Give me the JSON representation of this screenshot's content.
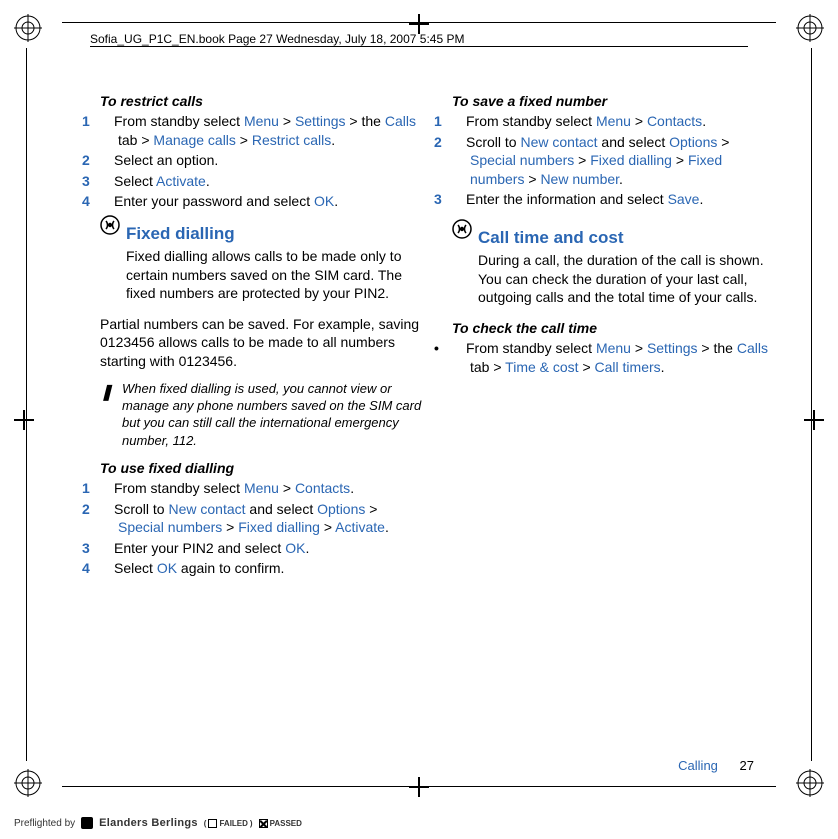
{
  "header": {
    "running_head": "Sofia_UG_P1C_EN.book  Page 27  Wednesday, July 18, 2007  5:45 PM"
  },
  "left": {
    "restrict": {
      "title": "To restrict calls",
      "step1_a": "From standby select ",
      "step1_menu": "Menu",
      "step1_gt1": " > ",
      "step1_settings": "Settings",
      "step1_b": " > the ",
      "step1_calls": "Calls",
      "step1_c": " tab > ",
      "step1_manage": "Manage calls",
      "step1_gt2": " > ",
      "step1_restrict": "Restrict calls",
      "step1_d": ".",
      "step2": "Select an option.",
      "step3_a": "Select ",
      "step3_activate": "Activate",
      "step3_b": ".",
      "step4_a": "Enter your password and select ",
      "step4_ok": "OK",
      "step4_b": "."
    },
    "fixed": {
      "title": "Fixed dialling",
      "p1": "Fixed dialling allows calls to be made only to certain numbers saved on the SIM card. The fixed numbers are protected by your PIN2.",
      "p2": "Partial numbers can be saved. For example, saving 0123456 allows calls to be made to all numbers starting with 0123456.",
      "note": "When fixed dialling is used, you cannot view or manage any phone numbers saved on the SIM card but you can still call the international emergency number, 112."
    },
    "use": {
      "title": "To use fixed dialling",
      "step1_a": "From standby select ",
      "step1_menu": "Menu",
      "step1_gt": " > ",
      "step1_contacts": "Contacts",
      "step1_b": ".",
      "step2_a": "Scroll to ",
      "step2_new": "New contact",
      "step2_b": " and select ",
      "step2_options": "Options",
      "step2_gt1": " > ",
      "step2_special": "Special numbers",
      "step2_gt2": " > ",
      "step2_fixed": "Fixed dialling",
      "step2_gt3": " > ",
      "step2_activate": "Activate",
      "step2_c": ".",
      "step3_a": "Enter your PIN2 and select ",
      "step3_ok": "OK",
      "step3_b": ".",
      "step4_a": "Select ",
      "step4_ok": "OK",
      "step4_b": " again to confirm."
    }
  },
  "right": {
    "save": {
      "title": "To save a fixed number",
      "step1_a": "From standby select ",
      "step1_menu": "Menu",
      "step1_gt": " > ",
      "step1_contacts": "Contacts",
      "step1_b": ".",
      "step2_a": "Scroll to ",
      "step2_new": "New contact",
      "step2_b": " and select ",
      "step2_options": "Options",
      "step2_gt1": " > ",
      "step2_special": "Special numbers",
      "step2_gt2": " > ",
      "step2_fixed": "Fixed dialling",
      "step2_gt3": " > ",
      "step2_fixednum": "Fixed numbers",
      "step2_gt4": " > ",
      "step2_newnum": "New number",
      "step2_c": ".",
      "step3_a": "Enter the information and select ",
      "step3_save": "Save",
      "step3_b": "."
    },
    "cost": {
      "title": "Call time and cost",
      "p1": "During a call, the duration of the call is shown. You can check the duration of your last call, outgoing calls and the total time of your calls."
    },
    "check": {
      "title": "To check the call time",
      "step1_a": "From standby select ",
      "step1_menu": "Menu",
      "step1_gt1": " > ",
      "step1_settings": "Settings",
      "step1_b": " > the ",
      "step1_calls": "Calls",
      "step1_c": " tab > ",
      "step1_time": "Time & cost",
      "step1_gt2": " > ",
      "step1_timers": "Call timers",
      "step1_d": "."
    }
  },
  "footer": {
    "section": "Calling",
    "page": "27"
  },
  "preflight": {
    "by": "Preflighted by",
    "brand": "Elanders Berlings",
    "failed": "FAILED",
    "passed": "PASSED"
  }
}
